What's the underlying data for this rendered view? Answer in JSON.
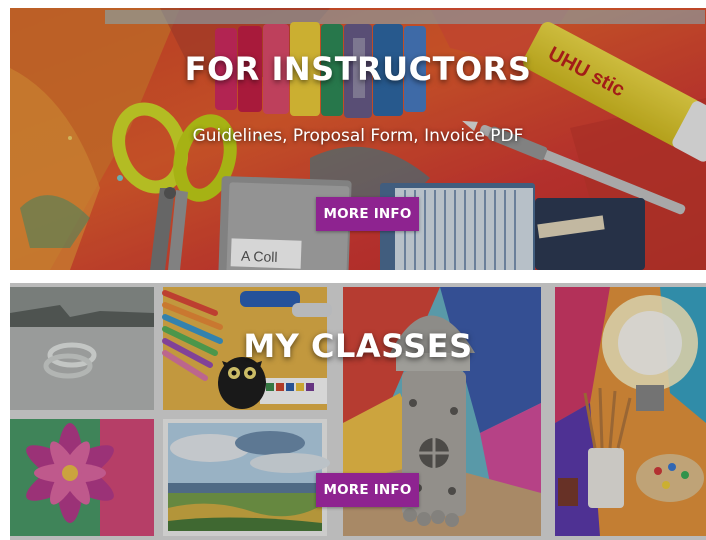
{
  "instructors": {
    "title": "FOR INSTRUCTORS",
    "subtitle": "Guidelines, Proposal Form, Invoice PDF",
    "button_label": "MORE INFO",
    "glue_label": "UHU stic",
    "notebook_label": "A Coll",
    "button_color": "#8e2390"
  },
  "classes": {
    "title": "MY CLASSES",
    "button_label": "MORE INFO",
    "button_color": "#8e2390"
  }
}
